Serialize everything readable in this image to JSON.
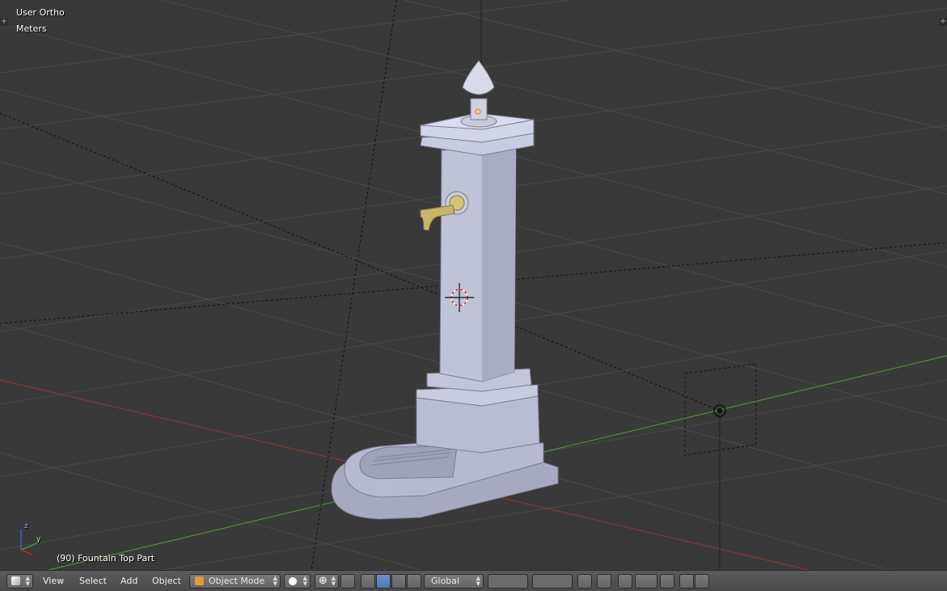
{
  "viewport": {
    "view_name": "User Ortho",
    "units": "Meters",
    "object_info": "(90) Fountain Top Part",
    "axis_labels": {
      "z": "z",
      "y": "y"
    }
  },
  "header": {
    "menus": [
      "View",
      "Select",
      "Add",
      "Object"
    ],
    "mode": "Object Mode",
    "transform_orientation": "Global"
  },
  "icons": {
    "editor_type": "cube-icon",
    "shading": "solid-sphere-icon",
    "pivot": "pivot-point-icon",
    "manipulator": "manipulator-icon",
    "layers": "layers-grid-icon",
    "render": "camera-icon"
  },
  "colors": {
    "viewport_bg": "#393939",
    "grid": "#4a4a4a",
    "x_axis": "#8a3535",
    "y_axis": "#4f8f3a",
    "model": "#b6b9cf",
    "brass": "#c8b46a"
  }
}
